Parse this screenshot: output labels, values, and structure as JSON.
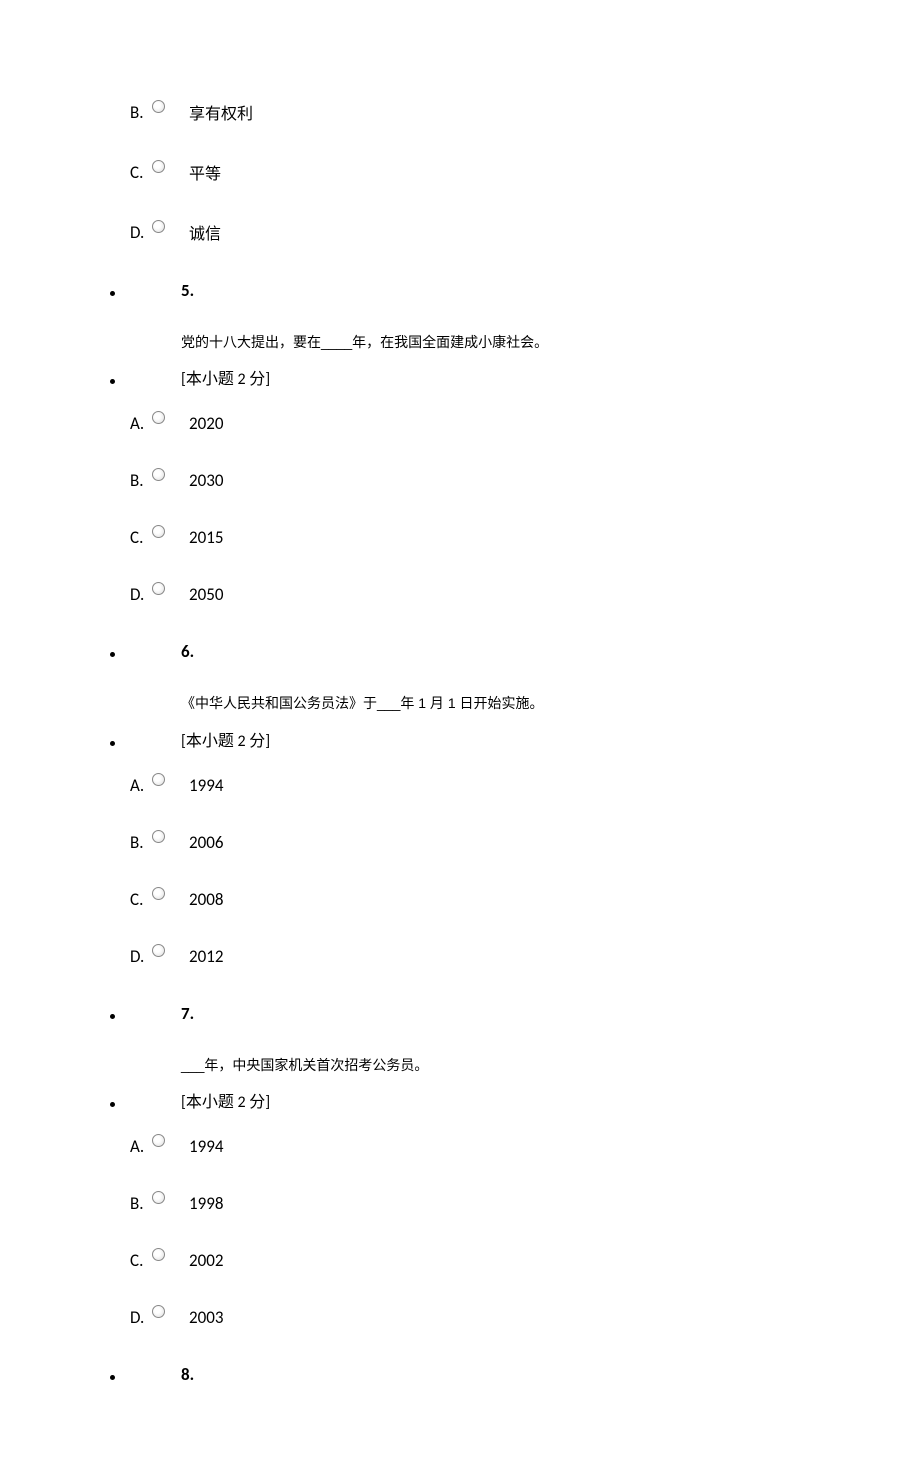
{
  "questions_prefix": {
    "options": [
      {
        "letter": "B.",
        "text": "享有权利",
        "numeric": false
      },
      {
        "letter": "C.",
        "text": "平等",
        "numeric": false
      },
      {
        "letter": "D.",
        "text": "诚信",
        "numeric": false
      }
    ]
  },
  "questions": [
    {
      "number": "5.",
      "text": "党的十八大提出，要在____年，在我国全面建成小康社会。",
      "points": "[本小题 2 分]",
      "options": [
        {
          "letter": "A.",
          "text": "2020",
          "numeric": true
        },
        {
          "letter": "B.",
          "text": "2030",
          "numeric": true
        },
        {
          "letter": "C.",
          "text": "2015",
          "numeric": true
        },
        {
          "letter": "D.",
          "text": "2050",
          "numeric": true
        }
      ]
    },
    {
      "number": "6.",
      "text": "《中华人民共和国公务员法》于___年 1 月 1 日开始实施。",
      "points": "[本小题 2 分]",
      "options": [
        {
          "letter": "A.",
          "text": "1994",
          "numeric": true
        },
        {
          "letter": "B.",
          "text": "2006",
          "numeric": true
        },
        {
          "letter": "C.",
          "text": "2008",
          "numeric": true
        },
        {
          "letter": "D.",
          "text": "2012",
          "numeric": true
        }
      ]
    },
    {
      "number": "7.",
      "text": "___年，中央国家机关首次招考公务员。",
      "points": "[本小题 2 分]",
      "options": [
        {
          "letter": "A.",
          "text": "1994",
          "numeric": true
        },
        {
          "letter": "B.",
          "text": "1998",
          "numeric": true
        },
        {
          "letter": "C.",
          "text": "2002",
          "numeric": true
        },
        {
          "letter": "D.",
          "text": "2003",
          "numeric": true
        }
      ]
    },
    {
      "number": "8.",
      "text": "",
      "points": "",
      "options": []
    }
  ]
}
